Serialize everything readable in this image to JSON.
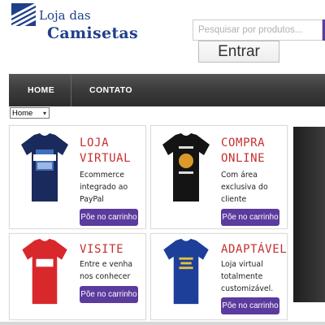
{
  "brand": {
    "line1": "Loja das",
    "line2": "Camisetas"
  },
  "search": {
    "placeholder": "Pesquisar por produtos...",
    "submit_label": "Entrar"
  },
  "nav": {
    "items": [
      {
        "label": "HOME"
      },
      {
        "label": "CONTATO"
      }
    ]
  },
  "nav_select": {
    "selected": "Home"
  },
  "products": [
    {
      "title": "LOJA\nVIRTUAL",
      "description": "Ecommerce\nintegrado ao\nPayPal",
      "button": "Põe no carrinho",
      "shirt_color": "#1b2a5c"
    },
    {
      "title": "COMPRA\nONLINE",
      "description": "Com área\nexclusiva do\ncliente",
      "button": "Põe no carrinho",
      "shirt_color": "#141414"
    },
    {
      "title": "VISITE",
      "description": "Entre e venha\nnos conhecer",
      "button": "Põe no carrinho",
      "shirt_color": "#d8282c"
    },
    {
      "title": "ADAPTÁVEL",
      "description": "Loja virtual\ntotalmente\ncustomizável.",
      "button": "Põe no carrinho",
      "shirt_color": "#1d3f9a"
    }
  ],
  "colors": {
    "accent_title": "#c62f2f",
    "button": "#5b3b9d",
    "brand": "#1f3f8a",
    "navbar": "#3a3a3a"
  }
}
